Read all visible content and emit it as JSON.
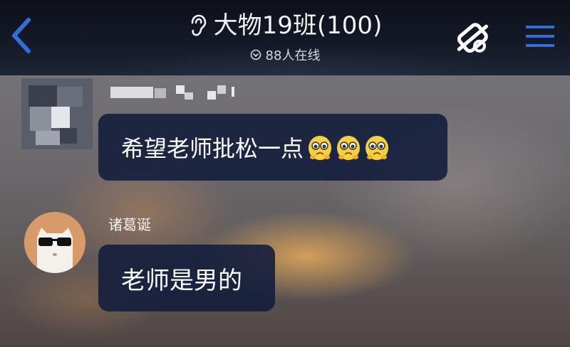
{
  "header": {
    "title": "大物19班(100)",
    "online": "88人在线",
    "icons": {
      "back": "chevron-left-icon",
      "ear": "ear-icon",
      "online": "online-status-icon",
      "mute": "notification-off-icon",
      "menu": "hamburger-menu-icon"
    },
    "accent_color": "#2f6fd6"
  },
  "messages": [
    {
      "sender": "",
      "text": "希望老师批松一点",
      "emoji_count": 3,
      "emoji_icon": "pleading-face-emoji-icon"
    },
    {
      "sender": "诸葛诞",
      "text": "老师是男的"
    }
  ],
  "colors": {
    "bubble": "#141e3c",
    "topbar": "#121726"
  }
}
